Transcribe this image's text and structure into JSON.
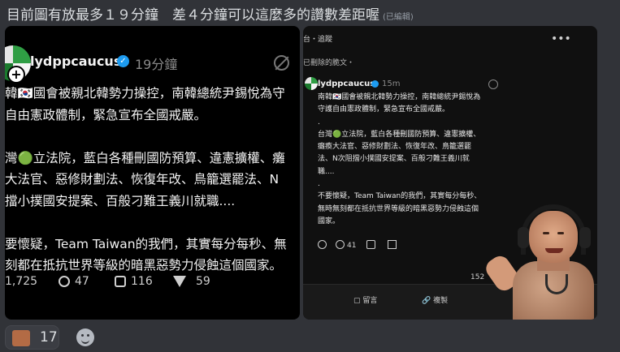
{
  "message": {
    "text": "目前圖有放最多１９分鐘　差４分鐘可以這麼多的讚數差距喔",
    "edited": "(已編輯)"
  },
  "left_post": {
    "username": "lydppcaucus",
    "time": "19分鐘",
    "body_lines": [
      "韓🇰🇷國會被親北韓勢力操控，南韓總統尹錫悅為守",
      "自由憲政體制，緊急宣布全國戒嚴。",
      "",
      "灣🟢立法院，藍白各種刪國防預算、違憲擴權、癱",
      "大法官、惡修財劃法、恢復年改、鳥籠選罷法、N",
      "擋小撲國安提案、百般刁難王義川就職....",
      "",
      "要懷疑，Team Taiwan的我們，其實每分每秒、無",
      "刻都在抵抗世界等級的暗黑惡勢力侵蝕這個國家。"
    ],
    "likes": "1,725",
    "comments": "47",
    "reposts": "116",
    "shares": "59"
  },
  "right_post": {
    "topbar": "台・追蹤",
    "deleted_note": "已刪除的脆文・",
    "username": "lydppcaucus",
    "time": "15m",
    "body_lines": [
      "南韓🇰🇷國會被親北韓勢力操控，南韓總統尹錫悅為",
      "守護自由憲政體制，緊急宣布全國戒嚴。",
      ".",
      "台灣🟢立法院，藍白各種刪國防預算、違憲擴權、",
      "癱瘓大法官、惡修財劃法、恢復年改、鳥籠選罷",
      "法、N次阻擋小撲國安提案、百般刁難王義川就",
      "職....",
      ".",
      "不要懷疑，Team Taiwan的我們，其實每分每秒、",
      "無時無刻都在抵抗世界等級的暗黑惡勢力侵蝕這個",
      "國家。"
    ],
    "comments": "41",
    "counter": "152",
    "reply": "留言",
    "copy": "複製"
  },
  "reactions": {
    "count": "17"
  }
}
